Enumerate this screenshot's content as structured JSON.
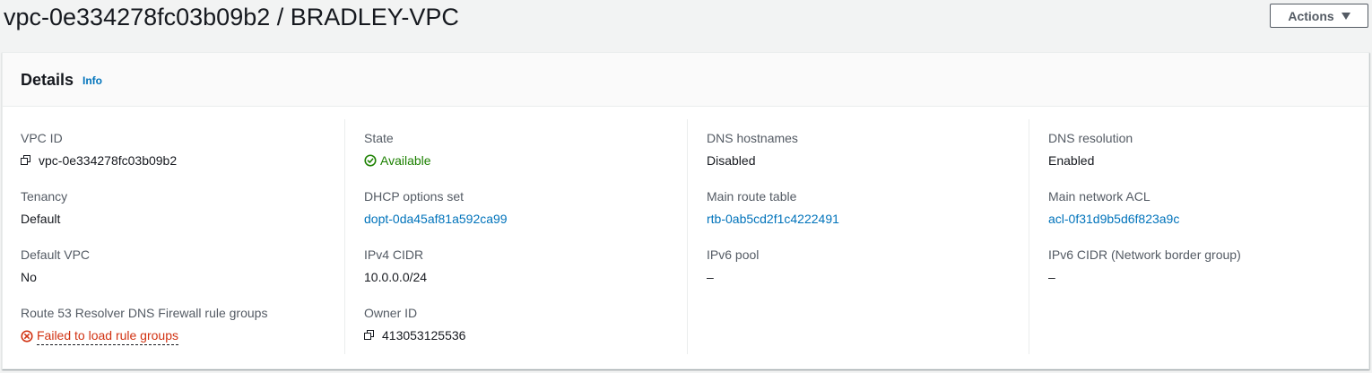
{
  "header": {
    "title": "vpc-0e334278fc03b09b2 / BRADLEY-VPC",
    "actions_label": "Actions"
  },
  "details": {
    "title": "Details",
    "info_label": "Info",
    "columns": [
      [
        {
          "key": "VPC ID",
          "value": "vpc-0e334278fc03b09b2"
        },
        {
          "key": "Tenancy",
          "value": "Default"
        },
        {
          "key": "Default VPC",
          "value": "No"
        },
        {
          "key": "Route 53 Resolver DNS Firewall rule groups",
          "value": "Failed to load rule groups"
        }
      ],
      [
        {
          "key": "State",
          "value": "Available"
        },
        {
          "key": "DHCP options set",
          "value": "dopt-0da45af81a592ca99"
        },
        {
          "key": "IPv4 CIDR",
          "value": "10.0.0.0/24"
        },
        {
          "key": "Owner ID",
          "value": "413053125536"
        }
      ],
      [
        {
          "key": "DNS hostnames",
          "value": "Disabled"
        },
        {
          "key": "Main route table",
          "value": "rtb-0ab5cd2f1c4222491"
        },
        {
          "key": "IPv6 pool",
          "value": "–"
        }
      ],
      [
        {
          "key": "DNS resolution",
          "value": "Enabled"
        },
        {
          "key": "Main network ACL",
          "value": "acl-0f31d9b5d6f823a9c"
        },
        {
          "key": "IPv6 CIDR (Network border group)",
          "value": "–"
        }
      ]
    ]
  },
  "icons": {
    "copy": "copy-icon",
    "success": "check-circle-icon",
    "error": "x-circle-icon",
    "caret": "caret-down-icon"
  },
  "colors": {
    "link": "#0073bb",
    "success": "#1d8102",
    "error": "#d13212",
    "background": "#f2f3f3"
  }
}
